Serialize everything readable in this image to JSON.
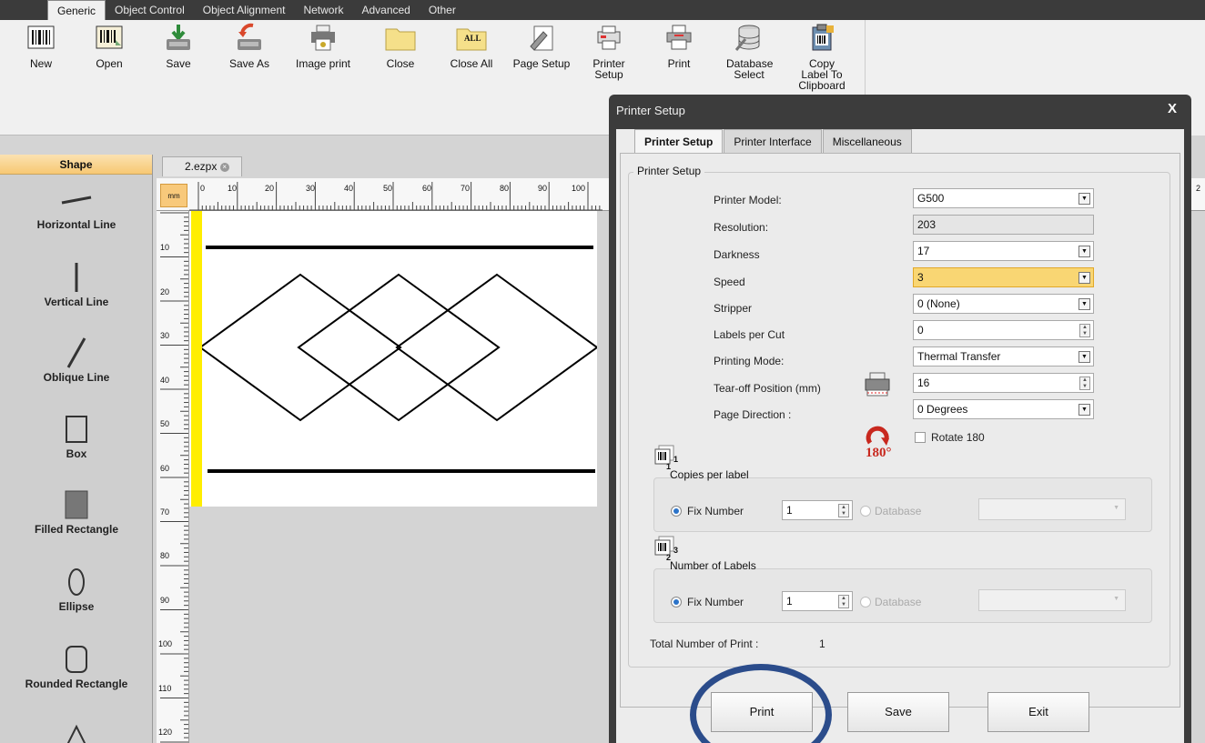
{
  "menu": {
    "tabs": [
      "Generic",
      "Object Control",
      "Object Alignment",
      "Network",
      "Advanced",
      "Other"
    ],
    "active": "Generic"
  },
  "toolbar": {
    "new": "New",
    "open": "Open",
    "save": "Save",
    "save_as": "Save As",
    "image_print": "Image print",
    "close": "Close",
    "close_all": "Close All",
    "close_all_icon_text": "ALL",
    "page_setup": "Page Setup",
    "printer_setup": "Printer Setup",
    "print": "Print",
    "database_select": "Database Select",
    "copy_label": "Copy Label To Clipboard"
  },
  "shape_panel": {
    "title": "Shape",
    "items": [
      "Horizontal Line",
      "Vertical Line",
      "Oblique Line",
      "Box",
      "Filled Rectangle",
      "Ellipse",
      "Rounded Rectangle"
    ]
  },
  "document": {
    "tab_name": "2.ezpx",
    "unit": "mm"
  },
  "ruler": {
    "top_ticks": [
      "0",
      "10",
      "20",
      "30",
      "40",
      "50",
      "60",
      "70",
      "80",
      "90",
      "100"
    ],
    "left_ticks": [
      "10",
      "20",
      "30",
      "40",
      "50",
      "60",
      "70",
      "80",
      "90",
      "100",
      "110",
      "120"
    ],
    "right_edge_tick": "2"
  },
  "dialog": {
    "title": "Printer Setup",
    "close": "X",
    "tabs": [
      "Printer Setup",
      "Printer Interface",
      "Miscellaneous"
    ],
    "active_tab": "Printer Setup",
    "group_title": "Printer Setup",
    "fields": {
      "printer_model": {
        "label": "Printer Model:",
        "value": "G500"
      },
      "resolution": {
        "label": "Resolution:",
        "value": "203"
      },
      "darkness": {
        "label": "Darkness",
        "value": "17"
      },
      "speed": {
        "label": "Speed",
        "value": "3"
      },
      "stripper": {
        "label": "Stripper",
        "value": "0 (None)"
      },
      "labels_per_cut": {
        "label": "Labels per Cut",
        "value": "0"
      },
      "printing_mode": {
        "label": "Printing Mode:",
        "value": "Thermal Transfer"
      },
      "tear_off": {
        "label": "Tear-off Position (mm)",
        "value": "16"
      },
      "page_direction": {
        "label": "Page Direction :",
        "value": "0 Degrees"
      }
    },
    "rotate_icon_text": "180°",
    "rotate_label": "Rotate 180",
    "rotate_checked": false,
    "copies": {
      "title": "Copies per label",
      "fix_label": "Fix Number",
      "fix_value": "1",
      "db_label": "Database",
      "icon_sup": "1",
      "icon_num": "1"
    },
    "labels": {
      "title": "Number of Labels",
      "fix_label": "Fix Number",
      "fix_value": "1",
      "db_label": "Database",
      "icon_sup": "3",
      "icon_num": "2"
    },
    "total_label": "Total Number of Print :",
    "total_value": "1",
    "buttons": {
      "print": "Print",
      "save": "Save",
      "exit": "Exit"
    }
  }
}
